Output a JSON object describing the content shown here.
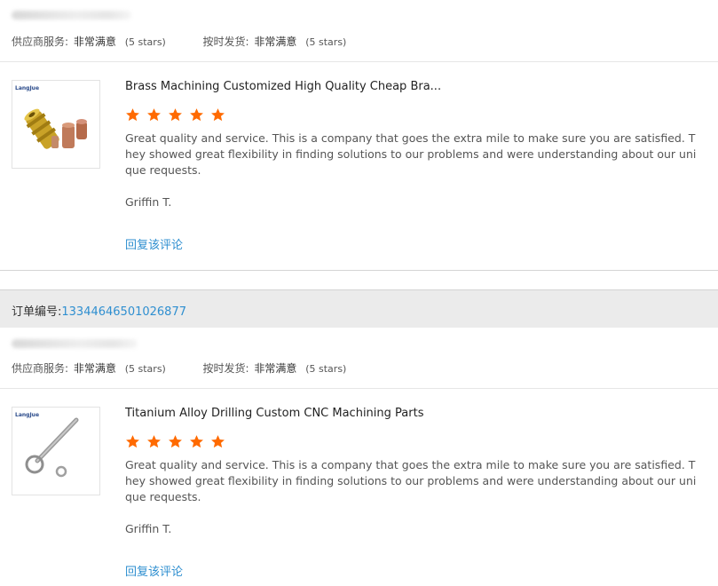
{
  "reviews": [
    {
      "ratings": {
        "supplier_label": "供应商服务:",
        "supplier_value": "非常满意",
        "supplier_stars": "(5 stars)",
        "ontime_label": "按时发货:",
        "ontime_value": "非常满意",
        "ontime_stars": "(5 stars)"
      },
      "product": {
        "brand": "LangJue",
        "title": "Brass Machining Customized High Quality Cheap Bra...",
        "rating": 5
      },
      "text": "Great quality and service. This is a company that goes the extra mile to make sure you are satisfied. They showed great flexibility in finding solutions to our problems and were understanding about our unique requests.",
      "reviewer": "Griffin T.",
      "reply_label": "回复该评论"
    },
    {
      "ratings": {
        "supplier_label": "供应商服务:",
        "supplier_value": "非常满意",
        "supplier_stars": "(5 stars)",
        "ontime_label": "按时发货:",
        "ontime_value": "非常满意",
        "ontime_stars": "(5 stars)"
      },
      "product": {
        "brand": "LangJue",
        "title": "Titanium Alloy Drilling Custom CNC Machining Parts",
        "rating": 5
      },
      "text": "Great quality and service. This is a company that goes the extra mile to make sure you are satisfied. They showed great flexibility in finding solutions to our problems and were understanding about our unique requests.",
      "reviewer": "Griffin T.",
      "reply_label": "回复该评论"
    }
  ],
  "order": {
    "label": "订单编号:",
    "number": "13344646501026877"
  },
  "colors": {
    "star": "#ff6a00",
    "link": "#2f8fd0",
    "order_bar_bg": "#ebebeb"
  },
  "icons": {
    "star": "star-icon"
  }
}
